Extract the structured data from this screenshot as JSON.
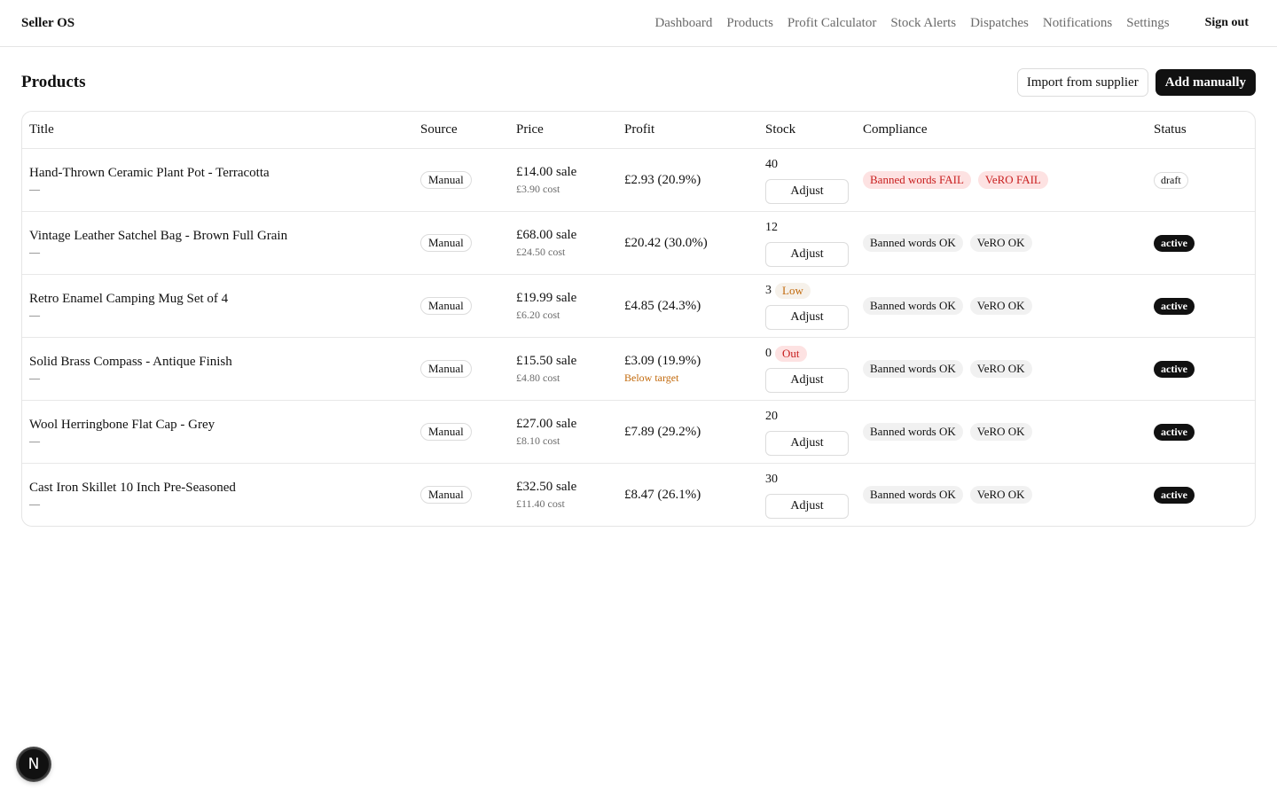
{
  "header": {
    "brand": "Seller OS",
    "nav": [
      "Dashboard",
      "Products",
      "Profit Calculator",
      "Stock Alerts",
      "Dispatches",
      "Notifications",
      "Settings"
    ],
    "sign_out": "Sign out"
  },
  "page": {
    "title": "Products",
    "import_label": "Import from supplier",
    "add_label": "Add manually"
  },
  "table": {
    "columns": [
      "Title",
      "Source",
      "Price",
      "Profit",
      "Stock",
      "Compliance",
      "Status"
    ],
    "adjust_label": "Adjust",
    "rows": [
      {
        "title": "Hand-Thrown Ceramic Plant Pot - Terracotta",
        "subtitle": "—",
        "source": "Manual",
        "sale": "£14.00 sale",
        "cost": "£3.90 cost",
        "profit": "£2.93 (20.9%)",
        "profit_note": "",
        "stock": "40",
        "stock_flag": "",
        "banned": "Banned words FAIL",
        "vero": "VeRO FAIL",
        "compliance_ok": false,
        "status": "draft"
      },
      {
        "title": "Vintage Leather Satchel Bag - Brown Full Grain",
        "subtitle": "—",
        "source": "Manual",
        "sale": "£68.00 sale",
        "cost": "£24.50 cost",
        "profit": "£20.42 (30.0%)",
        "profit_note": "",
        "stock": "12",
        "stock_flag": "",
        "banned": "Banned words OK",
        "vero": "VeRO OK",
        "compliance_ok": true,
        "status": "active"
      },
      {
        "title": "Retro Enamel Camping Mug Set of 4",
        "subtitle": "—",
        "source": "Manual",
        "sale": "£19.99 sale",
        "cost": "£6.20 cost",
        "profit": "£4.85 (24.3%)",
        "profit_note": "",
        "stock": "3",
        "stock_flag": "Low",
        "banned": "Banned words OK",
        "vero": "VeRO OK",
        "compliance_ok": true,
        "status": "active"
      },
      {
        "title": "Solid Brass Compass - Antique Finish",
        "subtitle": "—",
        "source": "Manual",
        "sale": "£15.50 sale",
        "cost": "£4.80 cost",
        "profit": "£3.09 (19.9%)",
        "profit_note": "Below target",
        "stock": "0",
        "stock_flag": "Out",
        "banned": "Banned words OK",
        "vero": "VeRO OK",
        "compliance_ok": true,
        "status": "active"
      },
      {
        "title": "Wool Herringbone Flat Cap - Grey",
        "subtitle": "—",
        "source": "Manual",
        "sale": "£27.00 sale",
        "cost": "£8.10 cost",
        "profit": "£7.89 (29.2%)",
        "profit_note": "",
        "stock": "20",
        "stock_flag": "",
        "banned": "Banned words OK",
        "vero": "VeRO OK",
        "compliance_ok": true,
        "status": "active"
      },
      {
        "title": "Cast Iron Skillet 10 Inch Pre-Seasoned",
        "subtitle": "—",
        "source": "Manual",
        "sale": "£32.50 sale",
        "cost": "£11.40 cost",
        "profit": "£8.47 (26.1%)",
        "profit_note": "",
        "stock": "30",
        "stock_flag": "",
        "banned": "Banned words OK",
        "vero": "VeRO OK",
        "compliance_ok": true,
        "status": "active"
      }
    ]
  },
  "fab": {
    "label": "N"
  }
}
